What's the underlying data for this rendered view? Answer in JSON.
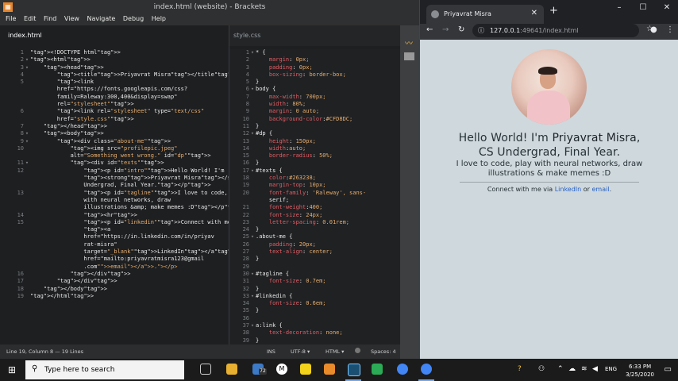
{
  "brackets": {
    "title": "index.html (website) - Brackets",
    "menu": [
      "File",
      "Edit",
      "Find",
      "View",
      "Navigate",
      "Debug",
      "Help"
    ],
    "left_tab": "index.html",
    "right_tab": "style.css",
    "status": {
      "position": "Line 19, Column 8 — 19 Lines",
      "ins": "INS",
      "encoding": "UTF-8 ▾",
      "language": "HTML ▾",
      "spaces": "Spaces: 4"
    }
  },
  "html_code": [
    {
      "n": "1",
      "f": "",
      "t": "<!DOCTYPE html>"
    },
    {
      "n": "2",
      "f": "▾",
      "t": "<html>"
    },
    {
      "n": "3",
      "f": "▾",
      "t": "    <head>"
    },
    {
      "n": "4",
      "f": "",
      "t": "        <title>Priyavrat Misra</title>"
    },
    {
      "n": "5",
      "f": "",
      "t": "        <link"
    },
    {
      "n": "",
      "f": "",
      "t": "        href=\"https://fonts.googleapis.com/css?"
    },
    {
      "n": "",
      "f": "",
      "t": "        family=Raleway:300,400&display=swap\""
    },
    {
      "n": "",
      "f": "",
      "t": "        rel=\"stylesheet\">"
    },
    {
      "n": "6",
      "f": "",
      "t": "        <link rel=\"stylesheet\" type=\"text/css\""
    },
    {
      "n": "",
      "f": "",
      "t": "        href=\"style.css\">"
    },
    {
      "n": "7",
      "f": "",
      "t": "    </head>"
    },
    {
      "n": "8",
      "f": "▾",
      "t": "    <body>"
    },
    {
      "n": "9",
      "f": "▾",
      "t": "        <div class=\"about-me\">"
    },
    {
      "n": "10",
      "f": "",
      "t": "            <img src=\"profilepic.jpeg\""
    },
    {
      "n": "",
      "f": "",
      "t": "            alt=\"Something went wrong.\" id=\"dp\">"
    },
    {
      "n": "11",
      "f": "▾",
      "t": "            <div id=\"texts\">"
    },
    {
      "n": "12",
      "f": "",
      "t": "                <p id=\"intro\">Hello World! I'm"
    },
    {
      "n": "",
      "f": "",
      "t": "                <strong>Priyavrat Misra</strong>, CS"
    },
    {
      "n": "",
      "f": "",
      "t": "                Undergrad, Final Year.</p>"
    },
    {
      "n": "13",
      "f": "",
      "t": "                <p id=\"tagline\">I love to code, play"
    },
    {
      "n": "",
      "f": "",
      "t": "                with neural networks, draw"
    },
    {
      "n": "",
      "f": "",
      "t": "                illustrations &amp; make memes :D</p>"
    },
    {
      "n": "14",
      "f": "",
      "t": "                <hr>"
    },
    {
      "n": "15",
      "f": "",
      "t": "                <p id=\"linkedin\">Connect with me via"
    },
    {
      "n": "",
      "f": "",
      "t": "                <a"
    },
    {
      "n": "",
      "f": "",
      "t": "                href=\"https://in.linkedin.com/in/priyav"
    },
    {
      "n": "",
      "f": "",
      "t": "                rat-misra\""
    },
    {
      "n": "",
      "f": "",
      "t": "                target=\"_blank\">LinkedIn</a> or <a"
    },
    {
      "n": "",
      "f": "",
      "t": "                href=\"mailto:priyavratmisra123@gmail"
    },
    {
      "n": "",
      "f": "",
      "t": "                .com\">email</a>.</p>"
    },
    {
      "n": "16",
      "f": "",
      "t": "            </div>"
    },
    {
      "n": "17",
      "f": "",
      "t": "        </div>"
    },
    {
      "n": "18",
      "f": "",
      "t": "    </body>"
    },
    {
      "n": "19",
      "f": "",
      "t": "</html>"
    }
  ],
  "css_code": [
    {
      "n": "1",
      "f": "▾",
      "t": "* {"
    },
    {
      "n": "2",
      "f": "",
      "t": "    margin: 0px;"
    },
    {
      "n": "3",
      "f": "",
      "t": "    padding: 0px;"
    },
    {
      "n": "4",
      "f": "",
      "t": "    box-sizing: border-box;"
    },
    {
      "n": "5",
      "f": "",
      "t": "}"
    },
    {
      "n": "6",
      "f": "▾",
      "t": "body {"
    },
    {
      "n": "7",
      "f": "",
      "t": "    max-width: 700px;"
    },
    {
      "n": "8",
      "f": "",
      "t": "    width: 80%;"
    },
    {
      "n": "9",
      "f": "",
      "t": "    margin: 0 auto;"
    },
    {
      "n": "10",
      "f": "",
      "t": "    background-color:#CFD8DC;"
    },
    {
      "n": "11",
      "f": "",
      "t": "}"
    },
    {
      "n": "12",
      "f": "▾",
      "t": "#dp {"
    },
    {
      "n": "13",
      "f": "",
      "t": "    height: 150px;"
    },
    {
      "n": "14",
      "f": "",
      "t": "    width:auto;"
    },
    {
      "n": "15",
      "f": "",
      "t": "    border-radius: 50%;"
    },
    {
      "n": "16",
      "f": "",
      "t": "}"
    },
    {
      "n": "17",
      "f": "▾",
      "t": "#texts {"
    },
    {
      "n": "18",
      "f": "",
      "t": "    color:#263238;"
    },
    {
      "n": "19",
      "f": "",
      "t": "    margin-top: 10px;"
    },
    {
      "n": "20",
      "f": "",
      "t": "    font-family: 'Raleway', sans-"
    },
    {
      "n": "",
      "f": "",
      "t": "    serif;"
    },
    {
      "n": "21",
      "f": "",
      "t": "    font-weight:400;"
    },
    {
      "n": "22",
      "f": "",
      "t": "    font-size: 24px;"
    },
    {
      "n": "23",
      "f": "",
      "t": "    letter-spacing: 0.01rem;"
    },
    {
      "n": "24",
      "f": "",
      "t": "}"
    },
    {
      "n": "25",
      "f": "▾",
      "t": ".about-me {"
    },
    {
      "n": "26",
      "f": "",
      "t": "    padding: 20px;"
    },
    {
      "n": "27",
      "f": "",
      "t": "    text-align: center;"
    },
    {
      "n": "28",
      "f": "",
      "t": "}"
    },
    {
      "n": "29",
      "f": "",
      "t": ""
    },
    {
      "n": "30",
      "f": "▾",
      "t": "#tagline {"
    },
    {
      "n": "31",
      "f": "",
      "t": "    font-size: 0.7em;"
    },
    {
      "n": "32",
      "f": "",
      "t": "}"
    },
    {
      "n": "33",
      "f": "▾",
      "t": "#linkedin {"
    },
    {
      "n": "34",
      "f": "",
      "t": "    font-size: 0.6em;"
    },
    {
      "n": "35",
      "f": "",
      "t": "}"
    },
    {
      "n": "36",
      "f": "",
      "t": ""
    },
    {
      "n": "37",
      "f": "▾",
      "t": "a:link {"
    },
    {
      "n": "38",
      "f": "",
      "t": "    text-decoration: none;"
    },
    {
      "n": "39",
      "f": "",
      "t": "}"
    }
  ],
  "chrome": {
    "tab_title": "Priyavrat Misra",
    "url_host": "127.0.0.1",
    "url_rest": ":49641/index.html",
    "page": {
      "intro_prefix": "Hello World! I'm ",
      "intro_name": "Priyavrat Misra",
      "intro_suffix": ",",
      "intro_line2": "CS Undergrad, Final Year.",
      "tagline": "I love to code, play with neural networks, draw illustrations & make memes :D",
      "connect_prefix": "Connect with me via ",
      "linkedin_link": "LinkedIn",
      "or_text": " or ",
      "email_link": "email",
      "period": "."
    }
  },
  "taskbar": {
    "search_placeholder": "Type here to search",
    "mail_badge": "72",
    "lang": "ENG",
    "time": "6:33 PM",
    "date": "3/25/2020"
  }
}
